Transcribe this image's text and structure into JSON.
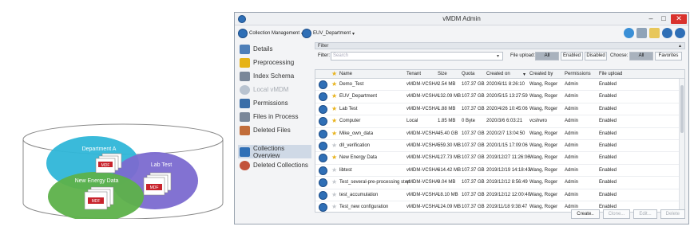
{
  "diagram": {
    "sets": [
      {
        "name": "Department A",
        "file_label": "MDF",
        "color": "#2fb6d8"
      },
      {
        "name": "Lab Test",
        "file_label": "MDF",
        "color": "#7b6ad0"
      },
      {
        "name": "New Energy Data",
        "file_label": "MDF",
        "color": "#5db14a"
      }
    ]
  },
  "window": {
    "title": "vMDM Admin",
    "min_label": "–",
    "max_label": "□",
    "close_label": "✕"
  },
  "toolbar": {
    "collection_management": "Collection Management",
    "department": "EUV_Department",
    "caret": "▾"
  },
  "sidebar": {
    "items": [
      {
        "label": "Details",
        "icon": "details-icon",
        "state": "normal",
        "color": "#4e7fb8"
      },
      {
        "label": "Preprocessing",
        "icon": "preprocessing-icon",
        "state": "normal",
        "color": "#e6b317"
      },
      {
        "label": "Index Schema",
        "icon": "index-schema-icon",
        "state": "normal",
        "color": "#7a8799"
      },
      {
        "label": "Local vMDM",
        "icon": "local-vmdm-icon",
        "state": "disabled",
        "color": "#b8c3d0"
      },
      {
        "label": "Permissions",
        "icon": "permissions-icon",
        "state": "normal",
        "color": "#3a6ea8"
      },
      {
        "label": "Files in Process",
        "icon": "files-in-process-icon",
        "state": "normal",
        "color": "#7a8799"
      },
      {
        "label": "Deleted Files",
        "icon": "deleted-files-icon",
        "state": "normal",
        "color": "#c26d3a"
      },
      {
        "label": "Collections Overview",
        "icon": "collections-overview-icon",
        "state": "active",
        "color": "#2f6fb6"
      },
      {
        "label": "Deleted Collections",
        "icon": "deleted-collections-icon",
        "state": "normal",
        "color": "#c2523a"
      }
    ]
  },
  "filter": {
    "section_label": "Filter",
    "collapse_glyph": "▴",
    "label": "Filter:",
    "placeholder": "Search",
    "dropdown_glyph": "▾",
    "file_upload_label": "File upload:",
    "file_upload_options": [
      "All",
      "Enabled",
      "Disabled"
    ],
    "file_upload_selected": "All",
    "choose_label": "Choose:",
    "choose_options": [
      "All",
      "Favorites"
    ],
    "choose_selected": "All"
  },
  "table": {
    "headers": {
      "name": "Name",
      "tenant": "Tenant",
      "size": "Size",
      "quota": "Quota",
      "created_on": "Created on",
      "created_by": "Created by",
      "permissions": "Permissions",
      "file_upload": "File upload",
      "sort_glyph": "▾"
    },
    "rows": [
      {
        "name": "Demo_Test",
        "fav": true,
        "tenant": "vMDM-VCSHA",
        "size": "2.54 MB",
        "quota": "107.37 GB",
        "created_on": "2020/6/11 8:26:10",
        "created_by": "Wang, Roger",
        "permissions": "Admin",
        "file_upload": "Enabled"
      },
      {
        "name": "EUV_Department",
        "fav": true,
        "tenant": "vMDM-VCSHA",
        "size": "132.09 MB",
        "quota": "107.37 GB",
        "created_on": "2020/5/15 13:27:59",
        "created_by": "Wang, Roger",
        "permissions": "Admin",
        "file_upload": "Enabled"
      },
      {
        "name": "Lab Test",
        "fav": true,
        "tenant": "vMDM-VCSHA",
        "size": "1.88 MB",
        "quota": "107.37 GB",
        "created_on": "2020/4/26 10:45:06",
        "created_by": "Wang, Roger",
        "permissions": "Admin",
        "file_upload": "Enabled"
      },
      {
        "name": "Computer",
        "fav": true,
        "tenant": "Local",
        "size": "1.85 MB",
        "quota": "0 Byte",
        "created_on": "2020/3/6 6:03:21",
        "created_by": "vcshwro",
        "permissions": "Admin",
        "file_upload": "Enabled"
      },
      {
        "name": "Mike_own_data",
        "fav": true,
        "tenant": "vMDM-VCSHA",
        "size": "45.40 GB",
        "quota": "107.37 GB",
        "created_on": "2020/2/7 13:04:50",
        "created_by": "Wang, Roger",
        "permissions": "Admin",
        "file_upload": "Enabled"
      },
      {
        "name": "dll_verification",
        "fav": false,
        "tenant": "vMDM-VCSHA",
        "size": "559.30 MB",
        "quota": "107.37 GB",
        "created_on": "2020/1/15 17:09:06",
        "created_by": "Wang, Roger",
        "permissions": "Admin",
        "file_upload": "Enabled"
      },
      {
        "name": "New Energy Data",
        "fav": true,
        "tenant": "vMDM-VCSHA",
        "size": "127.73 MB",
        "quota": "107.37 GB",
        "created_on": "2019/12/27 11:26:06",
        "created_by": "Wang, Roger",
        "permissions": "Admin",
        "file_upload": "Enabled"
      },
      {
        "name": "libtest",
        "fav": false,
        "tenant": "vMDM-VCSHA",
        "size": "614.42 MB",
        "quota": "107.37 GB",
        "created_on": "2019/12/19 14:18:43",
        "created_by": "Wang, Roger",
        "permissions": "Admin",
        "file_upload": "Enabled"
      },
      {
        "name": "Test_several-pre-processing step",
        "fav": false,
        "tenant": "vMDM-VCSHA",
        "size": "9.04 MB",
        "quota": "107.37 GB",
        "created_on": "2019/12/12 8:56:49",
        "created_by": "Wang, Roger",
        "permissions": "Admin",
        "file_upload": "Enabled"
      },
      {
        "name": "test_accumulation",
        "fav": false,
        "tenant": "vMDM-VCSHA",
        "size": "18.10 MB",
        "quota": "107.37 GB",
        "created_on": "2019/12/12 12:00:40",
        "created_by": "Wang, Roger",
        "permissions": "Admin",
        "file_upload": "Enabled"
      },
      {
        "name": "Test_new configuration",
        "fav": false,
        "tenant": "vMDM-VCSHA",
        "size": "124.09 MB",
        "quota": "107.37 GB",
        "created_on": "2019/11/18 9:38:47",
        "created_by": "Wang, Roger",
        "permissions": "Admin",
        "file_upload": "Enabled"
      }
    ]
  },
  "actions": {
    "create": "Create..",
    "clone": "Clone...",
    "edit": "Edit...",
    "delete": "Delete"
  }
}
